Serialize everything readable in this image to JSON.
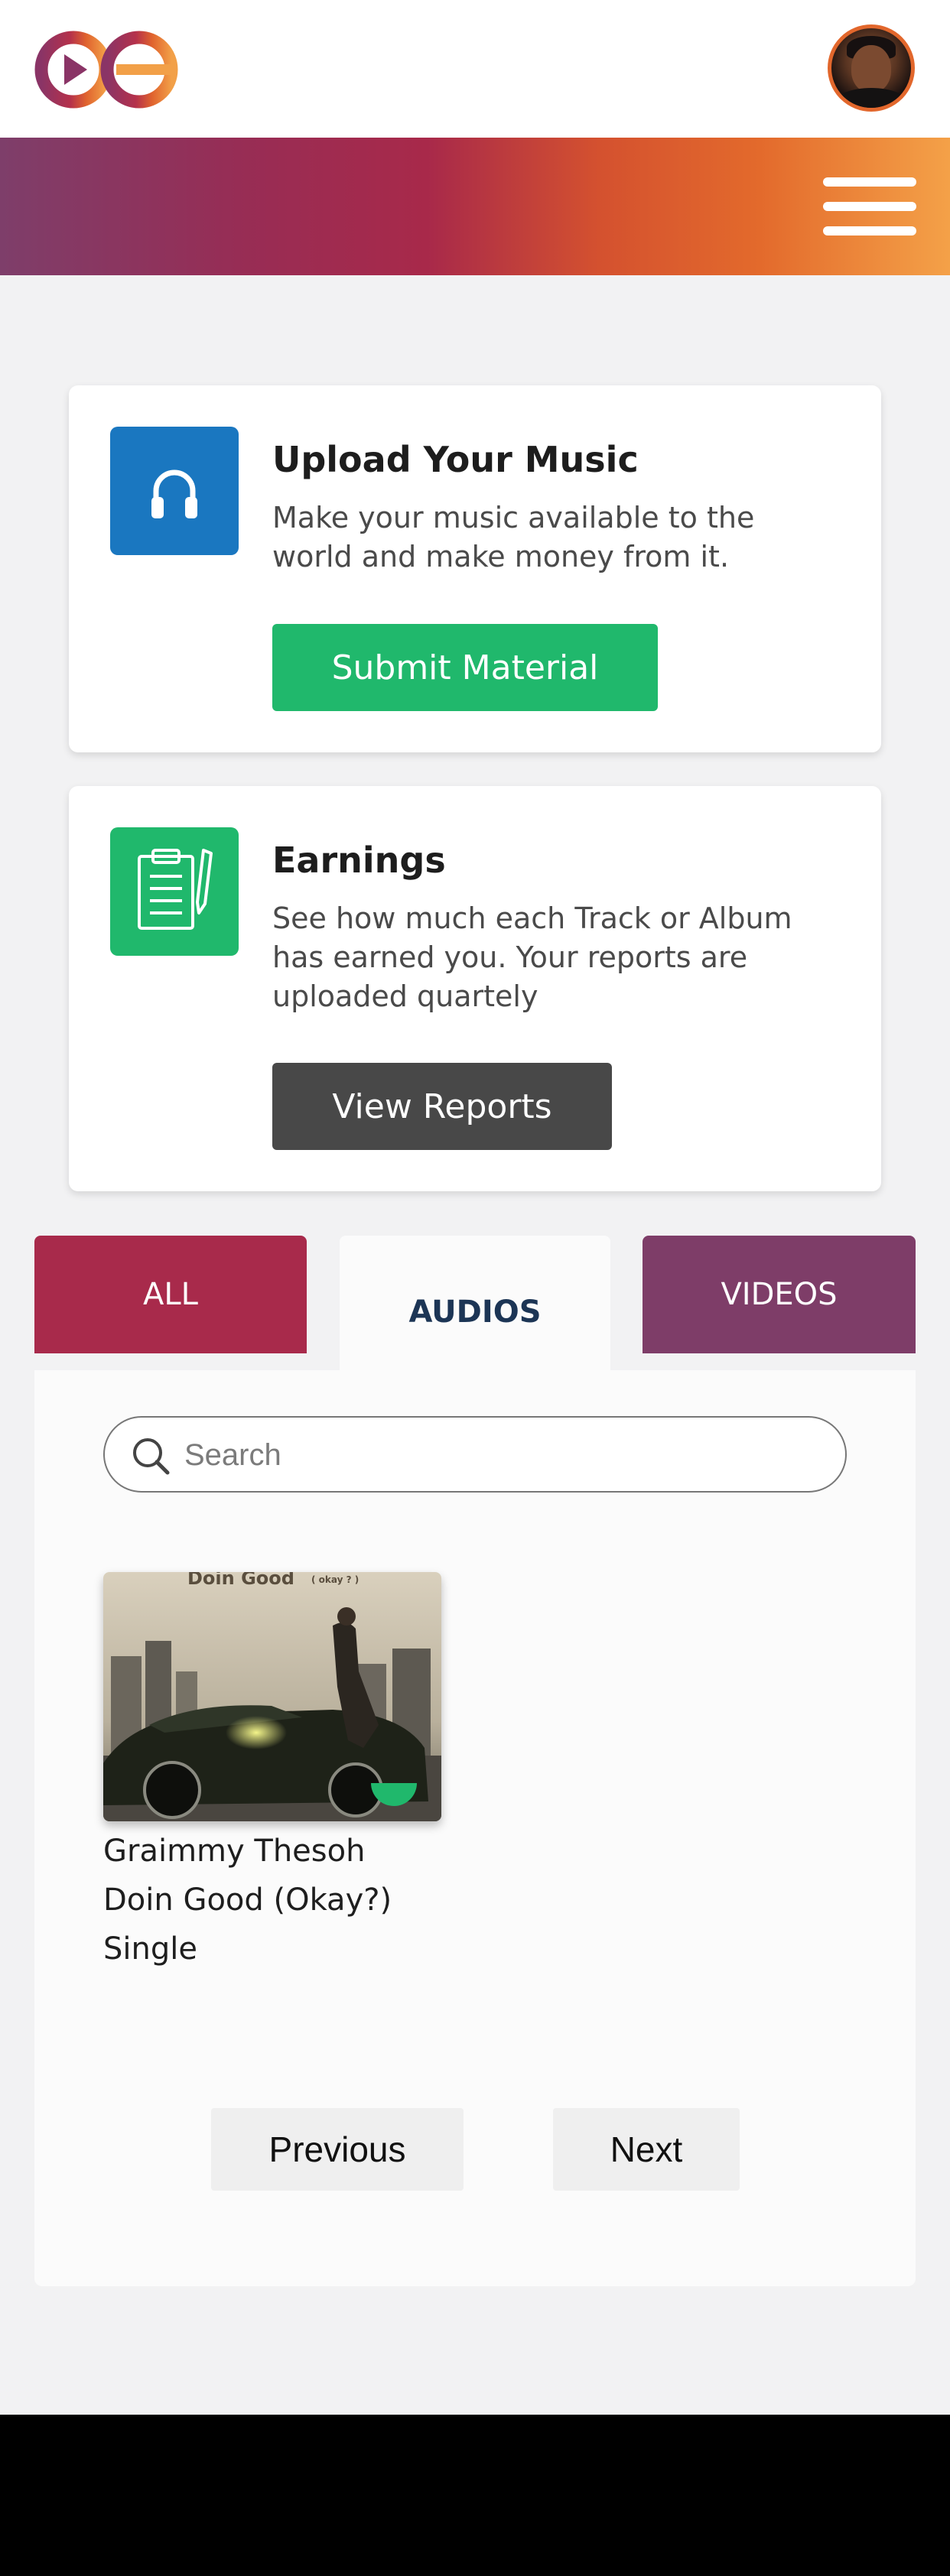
{
  "header": {
    "logo_icon": "play-infinity-logo",
    "avatar_icon": "user-avatar",
    "menu_icon": "hamburger-menu-icon"
  },
  "upload_card": {
    "icon": "headphones-icon",
    "title": "Upload Your Music",
    "description": "Make your music available to the world and make money from it.",
    "button_label": "Submit Material",
    "icon_color": "#1a77c0",
    "button_color": "#20b86c"
  },
  "earnings_card": {
    "icon": "clipboard-pen-icon",
    "title": "Earnings",
    "description": "See how much each Track or Album has earned you. Your reports are uploaded quartely",
    "button_label": "View Reports",
    "icon_color": "#20b86c",
    "button_color": "#484848"
  },
  "tabs": [
    {
      "label": "ALL",
      "color": "#a82a4b",
      "active": false
    },
    {
      "label": "AUDIOS",
      "color": "#fbfbfb",
      "active": true
    },
    {
      "label": "VIDEOS",
      "color": "#7e3d68",
      "active": false
    }
  ],
  "search": {
    "placeholder": "Search",
    "icon": "search-icon"
  },
  "album": {
    "cover_text": "Doin Good",
    "cover_subtext": "( okay ? )",
    "artist": "Graimmy Thesoh",
    "title": "Doin Good (Okay?)",
    "type": "Single"
  },
  "pagination": {
    "previous_label": "Previous",
    "next_label": "Next"
  }
}
